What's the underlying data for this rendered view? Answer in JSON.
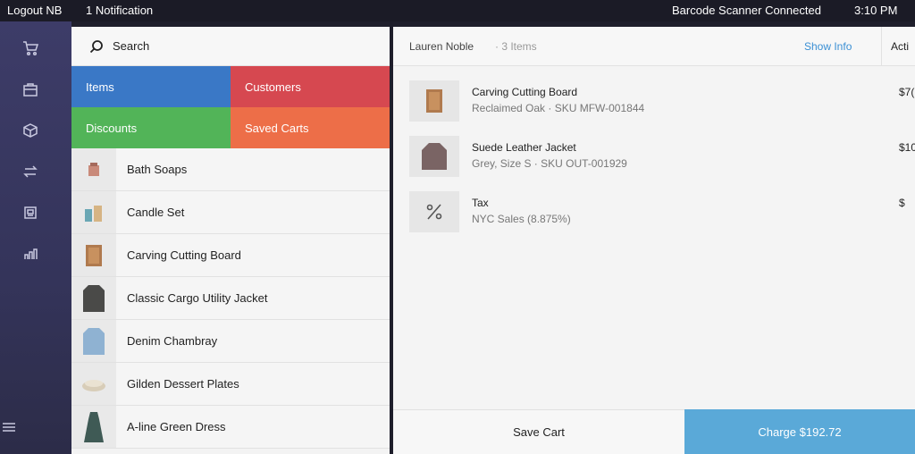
{
  "status_bar": {
    "logout": "Logout NB",
    "notifications": "1 Notification",
    "scanner": "Barcode Scanner Connected",
    "time": "3:10 PM"
  },
  "nav": {
    "icons": [
      "cart-icon",
      "briefcase-icon",
      "box-icon",
      "transfer-icon",
      "register-icon",
      "reports-icon",
      "menu-icon"
    ]
  },
  "library": {
    "search_placeholder": "Search",
    "tiles": {
      "items": "Items",
      "customers": "Customers",
      "discounts": "Discounts",
      "saved_carts": "Saved Carts"
    },
    "tile_colors": {
      "items": "#3a78c6",
      "customers": "#d64850",
      "discounts": "#52b458",
      "saved_carts": "#ed6e48"
    },
    "items": [
      {
        "label": "Bath Soaps"
      },
      {
        "label": "Candle Set"
      },
      {
        "label": "Carving Cutting Board"
      },
      {
        "label": "Classic Cargo Utility Jacket"
      },
      {
        "label": "Denim Chambray"
      },
      {
        "label": "Gilden Dessert Plates"
      },
      {
        "label": "A-line Green Dress"
      }
    ]
  },
  "cart": {
    "customer": "Lauren Noble",
    "count": "· 3 Items",
    "show_info": "Show Info",
    "actions": "Acti",
    "lines": [
      {
        "name": "Carving Cutting Board",
        "sub": "Reclaimed Oak · SKU MFW-001844",
        "price": "$7("
      },
      {
        "name": "Suede Leather Jacket",
        "sub": "Grey, Size S · SKU OUT-001929",
        "price": "$10"
      },
      {
        "name": "Tax",
        "sub": "NYC Sales (8.875%)",
        "price": "$"
      }
    ],
    "save_cart": "Save Cart",
    "charge": "Charge $192.72"
  }
}
